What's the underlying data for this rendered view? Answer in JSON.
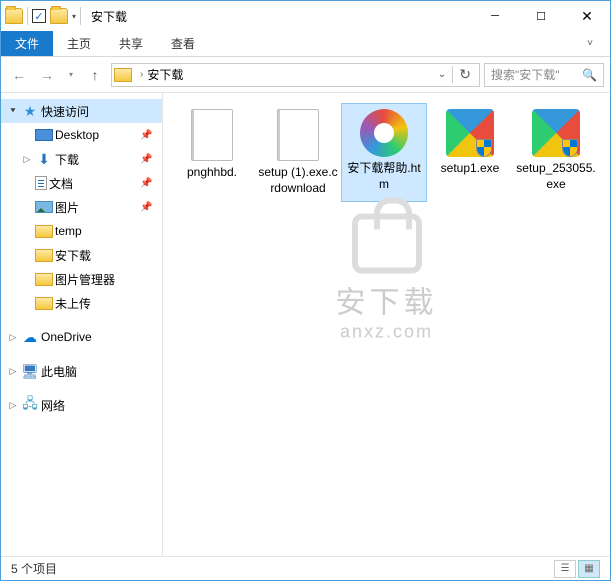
{
  "window": {
    "title": "安下载"
  },
  "ribbon": {
    "file": "文件",
    "tabs": [
      "主页",
      "共享",
      "查看"
    ]
  },
  "address": {
    "path": "安下载",
    "search_placeholder": "搜索\"安下载\""
  },
  "sidebar": {
    "quick": "快速访问",
    "items": [
      {
        "label": "Desktop",
        "icon": "desktop",
        "pin": true
      },
      {
        "label": "下载",
        "icon": "downloads",
        "pin": true
      },
      {
        "label": "文档",
        "icon": "docs",
        "pin": true
      },
      {
        "label": "图片",
        "icon": "pics",
        "pin": true
      },
      {
        "label": "temp",
        "icon": "folder",
        "pin": false
      },
      {
        "label": "安下载",
        "icon": "folder",
        "pin": false
      },
      {
        "label": "图片管理器",
        "icon": "folder",
        "pin": false
      },
      {
        "label": "未上传",
        "icon": "folder",
        "pin": false
      }
    ],
    "onedrive": "OneDrive",
    "thispc": "此电脑",
    "network": "网络"
  },
  "files": [
    {
      "name": "pnghhbd.",
      "type": "doc",
      "selected": false
    },
    {
      "name": "setup (1).exe.crdownload",
      "type": "doc",
      "selected": false
    },
    {
      "name": "安下载帮助.htm",
      "type": "colorwheel",
      "selected": true
    },
    {
      "name": "setup1.exe",
      "type": "exe",
      "selected": false,
      "shield": true
    },
    {
      "name": "setup_253055.exe",
      "type": "exe",
      "selected": false,
      "shield": true
    }
  ],
  "watermark": {
    "cn": "安下载",
    "en": "anxz.com"
  },
  "status": {
    "text": "5 个项目"
  }
}
